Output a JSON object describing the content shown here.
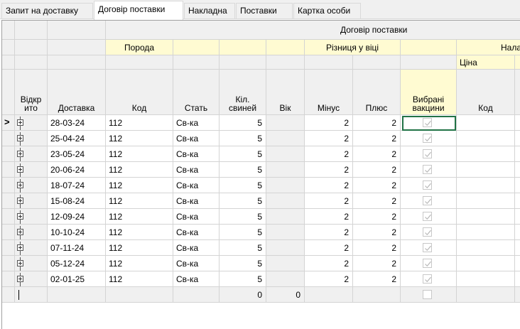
{
  "tabs": [
    {
      "label": "Запит на доставку",
      "active": false
    },
    {
      "label": "Договір поставки",
      "active": true
    },
    {
      "label": "Накладна",
      "active": false
    },
    {
      "label": "Поставки",
      "active": false
    },
    {
      "label": "Картка особи",
      "active": false
    }
  ],
  "headers": {
    "band_title": "Договір поставки",
    "breed": "Порода",
    "age_diff": "Різниця у віці",
    "settings_partial": "Налаш",
    "price": "Ціна",
    "columns": {
      "opened": "Відкр ито",
      "delivery": "Доставка",
      "code": "Код",
      "sex": "Стать",
      "pig_count": "Кіл. свиней",
      "age": "Вік",
      "minus": "Мінус",
      "plus": "Плюс",
      "vaccines": "Вибрані вакцини",
      "code2": "Код"
    }
  },
  "rows": [
    {
      "delivery": "28-03-24",
      "code": "112",
      "sex": "Св-ка",
      "pig_count": "5",
      "minus": "2",
      "plus": "2",
      "vaccine_checked": true,
      "current": true
    },
    {
      "delivery": "25-04-24",
      "code": "112",
      "sex": "Св-ка",
      "pig_count": "5",
      "minus": "2",
      "plus": "2",
      "vaccine_checked": true
    },
    {
      "delivery": "23-05-24",
      "code": "112",
      "sex": "Св-ка",
      "pig_count": "5",
      "minus": "2",
      "plus": "2",
      "vaccine_checked": true
    },
    {
      "delivery": "20-06-24",
      "code": "112",
      "sex": "Св-ка",
      "pig_count": "5",
      "minus": "2",
      "plus": "2",
      "vaccine_checked": true
    },
    {
      "delivery": "18-07-24",
      "code": "112",
      "sex": "Св-ка",
      "pig_count": "5",
      "minus": "2",
      "plus": "2",
      "vaccine_checked": true
    },
    {
      "delivery": "15-08-24",
      "code": "112",
      "sex": "Св-ка",
      "pig_count": "5",
      "minus": "2",
      "plus": "2",
      "vaccine_checked": true
    },
    {
      "delivery": "12-09-24",
      "code": "112",
      "sex": "Св-ка",
      "pig_count": "5",
      "minus": "2",
      "plus": "2",
      "vaccine_checked": true
    },
    {
      "delivery": "10-10-24",
      "code": "112",
      "sex": "Св-ка",
      "pig_count": "5",
      "minus": "2",
      "plus": "2",
      "vaccine_checked": true
    },
    {
      "delivery": "07-11-24",
      "code": "112",
      "sex": "Св-ка",
      "pig_count": "5",
      "minus": "2",
      "plus": "2",
      "vaccine_checked": true
    },
    {
      "delivery": "05-12-24",
      "code": "112",
      "sex": "Св-ка",
      "pig_count": "5",
      "minus": "2",
      "plus": "2",
      "vaccine_checked": true
    },
    {
      "delivery": "02-01-25",
      "code": "112",
      "sex": "Св-ка",
      "pig_count": "5",
      "minus": "2",
      "plus": "2",
      "vaccine_checked": true
    }
  ],
  "new_row": {
    "pig_count": "0",
    "age": "0",
    "vaccine_checked": false
  },
  "glyphs": {
    "current_row": ">"
  },
  "icons": {
    "expand": "plus-box-icon",
    "check": "checkmark-icon"
  },
  "colors": {
    "band": "#fffbd2",
    "header": "#f0f0f0",
    "focus": "#217346",
    "grid_line": "#d4d4d4"
  }
}
